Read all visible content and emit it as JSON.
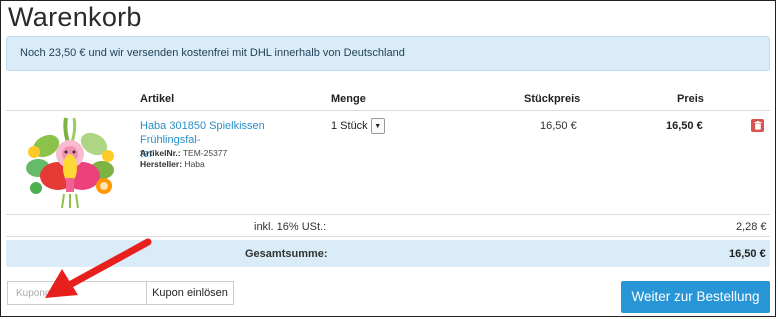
{
  "page": {
    "title": "Warenkorb"
  },
  "info_banner": "Noch 23,50 € und wir versenden kostenfrei mit DHL innerhalb von Deutschland",
  "table": {
    "headers": {
      "article": "Artikel",
      "quantity": "Menge",
      "unit_price": "Stückpreis",
      "price": "Preis"
    }
  },
  "item": {
    "name_line1": "Haba 301850 Spielkissen Frühlingsfal-",
    "name_line2": "ter",
    "article_no_label": "ArtikelNr.:",
    "article_no": "TEM-25377",
    "manufacturer_label": "Hersteller:",
    "manufacturer": "Haba",
    "quantity": "1 Stück",
    "unit_price": "16,50 €",
    "price": "16,50 €",
    "delete_icon": "trash-icon"
  },
  "summary": {
    "tax_label": "inkl. 16% USt.:",
    "tax_value": "2,28 €",
    "total_label": "Gesamtsumme:",
    "total_value": "16,50 €"
  },
  "coupon": {
    "placeholder": "Kuponcode",
    "value": "",
    "button": "Kupon einlösen"
  },
  "checkout_button": "Weiter zur Bestellung",
  "colors": {
    "info_bg": "#d9ecf8",
    "link": "#2b8fc9",
    "primary_button": "#2896d6",
    "delete": "#d9534f",
    "annotation_arrow": "#e8201d"
  }
}
